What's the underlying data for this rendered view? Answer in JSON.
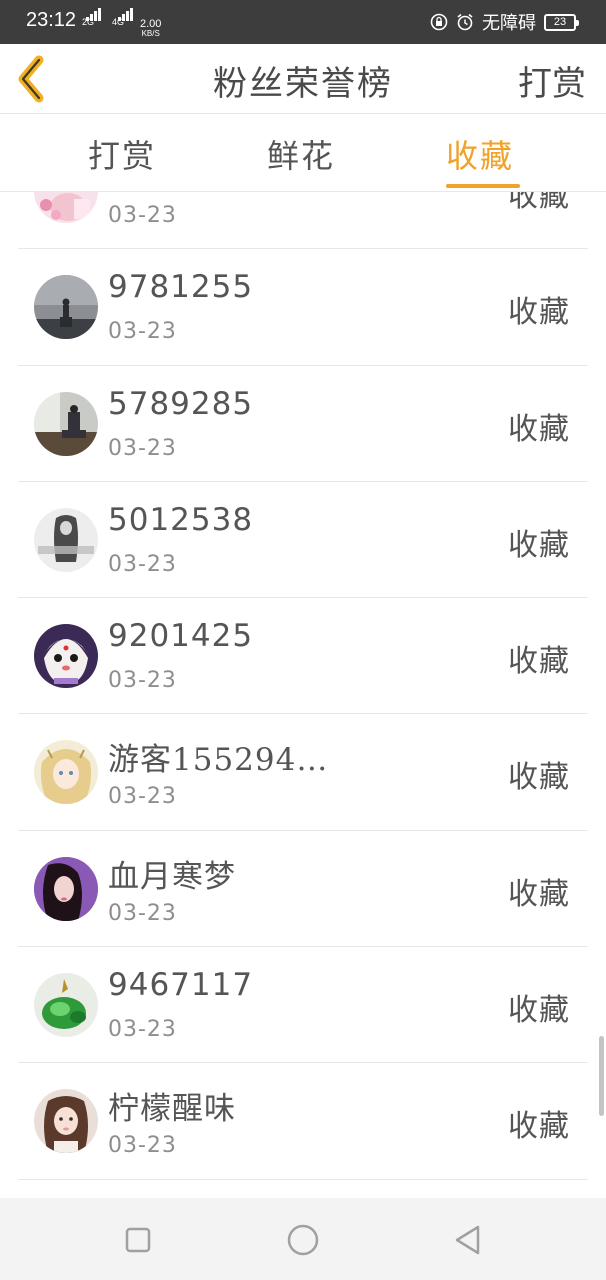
{
  "status_bar": {
    "time": "23:12",
    "net1": "2G",
    "net2": "4G",
    "speed_value": "2.00",
    "speed_unit": "KB/S",
    "accessibility": "无障碍",
    "battery": "23"
  },
  "header": {
    "title": "粉丝荣誉榜",
    "right_button": "打赏",
    "back_icon": "chevron-left-icon"
  },
  "tabs": [
    {
      "label": "打赏",
      "active": false
    },
    {
      "label": "鲜花",
      "active": false
    },
    {
      "label": "收藏",
      "active": true
    }
  ],
  "accent_color": "#f0a22a",
  "fans": [
    {
      "name": "",
      "date": "03-23",
      "action": "收藏",
      "avatar": "pink"
    },
    {
      "name": "9781255",
      "date": "03-23",
      "action": "收藏",
      "avatar": "night"
    },
    {
      "name": "5789285",
      "date": "03-23",
      "action": "收藏",
      "avatar": "window"
    },
    {
      "name": "5012538",
      "date": "03-23",
      "action": "收藏",
      "avatar": "girl-gray"
    },
    {
      "name": "9201425",
      "date": "03-23",
      "action": "收藏",
      "avatar": "cartoon"
    },
    {
      "name": "游客155294…",
      "date": "03-23",
      "action": "收藏",
      "avatar": "anime"
    },
    {
      "name": "血月寒梦",
      "date": "03-23",
      "action": "收藏",
      "avatar": "purple"
    },
    {
      "name": "9467117",
      "date": "03-23",
      "action": "收藏",
      "avatar": "jade"
    },
    {
      "name": "柠檬醒味",
      "date": "03-23",
      "action": "收藏",
      "avatar": "portrait"
    }
  ]
}
